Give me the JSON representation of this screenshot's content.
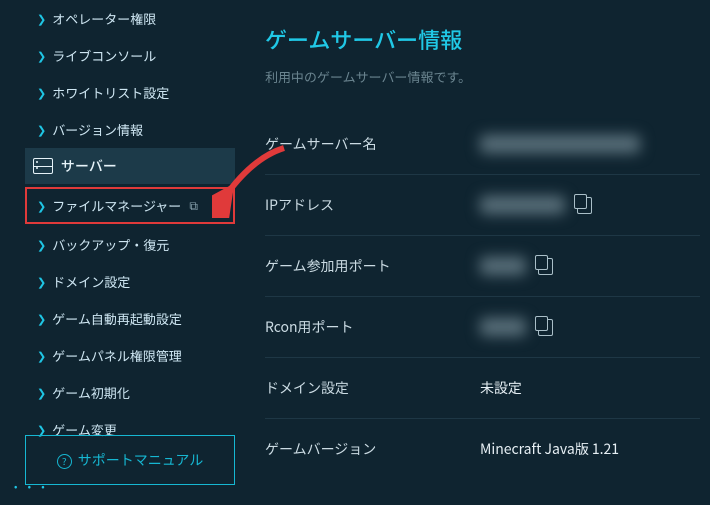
{
  "sidebar": {
    "group1": [
      {
        "label": "オペレーター権限"
      },
      {
        "label": "ライブコンソール"
      },
      {
        "label": "ホワイトリスト設定"
      },
      {
        "label": "バージョン情報"
      }
    ],
    "server_section": "サーバー",
    "group2": [
      {
        "label": "ファイルマネージャー",
        "highlight": true,
        "external": true
      },
      {
        "label": "バックアップ・復元"
      },
      {
        "label": "ドメイン設定"
      },
      {
        "label": "ゲーム自動再起動設定"
      },
      {
        "label": "ゲームパネル権限管理"
      },
      {
        "label": "ゲーム初期化"
      },
      {
        "label": "ゲーム変更"
      }
    ],
    "support_label": "サポートマニュアル"
  },
  "main": {
    "title": "ゲームサーバー情報",
    "subtitle": "利用中のゲームサーバー情報です。",
    "rows": [
      {
        "label": "ゲームサーバー名",
        "value": "(非表示)",
        "masked": "long",
        "copy": false
      },
      {
        "label": "IPアドレス",
        "value": "(非表示)",
        "masked": "mid",
        "copy": true
      },
      {
        "label": "ゲーム参加用ポート",
        "value": "(非表示)",
        "masked": "sm",
        "copy": true
      },
      {
        "label": "Rcon用ポート",
        "value": "(非表示)",
        "masked": "sm",
        "copy": true
      },
      {
        "label": "ドメイン設定",
        "value": "未設定",
        "masked": null,
        "copy": false
      },
      {
        "label": "ゲームバージョン",
        "value": "Minecraft Java版 1.21",
        "masked": null,
        "copy": false
      }
    ]
  }
}
